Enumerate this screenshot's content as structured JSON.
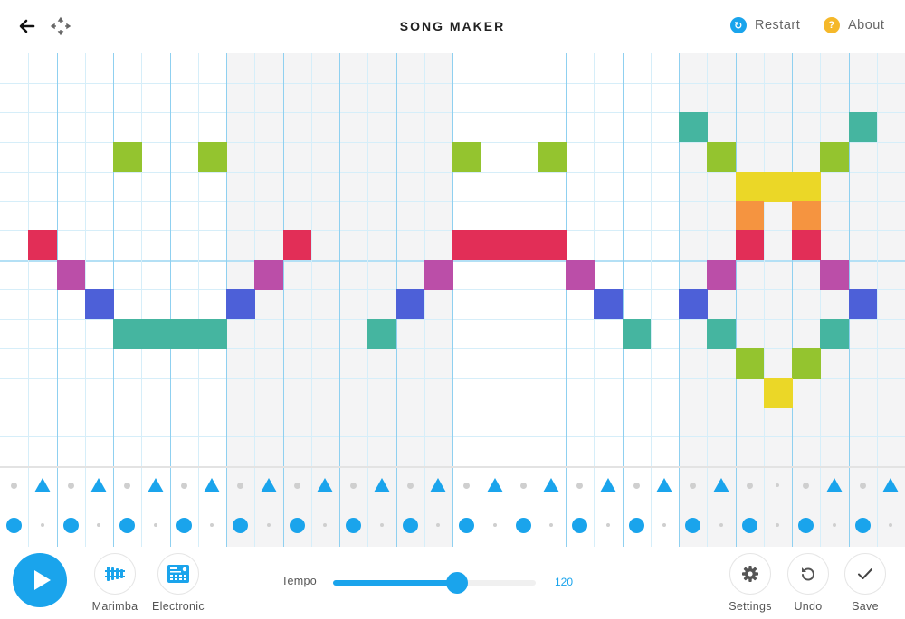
{
  "header": {
    "title": "SONG MAKER",
    "restart_label": "Restart",
    "about_label": "About",
    "restart_icon": "refresh-icon",
    "about_icon": "question-icon",
    "about_glyph": "?",
    "restart_glyph": "↻"
  },
  "colors": {
    "accent": "#1aa4ec",
    "about_accent": "#f5b82a",
    "shade": "#f4f4f5"
  },
  "grid": {
    "columns": 32,
    "rows": 14,
    "beats_per_bar": 4,
    "shaded_bars": [
      1,
      3
    ],
    "note_colors": {
      "teal": "#45b5a0",
      "green": "#94c42f",
      "yellow": "#ebd727",
      "orange": "#f59440",
      "red": "#e22e57",
      "purple": "#bb4ea8",
      "blue": "#4d60d8"
    },
    "notes": [
      {
        "col": 1,
        "row": 6,
        "color": "red"
      },
      {
        "col": 10,
        "row": 6,
        "color": "red"
      },
      {
        "col": 16,
        "row": 6,
        "color": "red"
      },
      {
        "col": 17,
        "row": 6,
        "color": "red"
      },
      {
        "col": 18,
        "row": 6,
        "color": "red"
      },
      {
        "col": 19,
        "row": 6,
        "color": "red"
      },
      {
        "col": 26,
        "row": 6,
        "color": "red"
      },
      {
        "col": 28,
        "row": 6,
        "color": "red"
      },
      {
        "col": 4,
        "row": 3,
        "color": "green"
      },
      {
        "col": 7,
        "row": 3,
        "color": "green"
      },
      {
        "col": 16,
        "row": 3,
        "color": "green"
      },
      {
        "col": 19,
        "row": 3,
        "color": "green"
      },
      {
        "col": 25,
        "row": 3,
        "color": "green"
      },
      {
        "col": 29,
        "row": 3,
        "color": "green"
      },
      {
        "col": 2,
        "row": 7,
        "color": "purple"
      },
      {
        "col": 9,
        "row": 7,
        "color": "purple"
      },
      {
        "col": 15,
        "row": 7,
        "color": "purple"
      },
      {
        "col": 20,
        "row": 7,
        "color": "purple"
      },
      {
        "col": 25,
        "row": 7,
        "color": "purple"
      },
      {
        "col": 29,
        "row": 7,
        "color": "purple"
      },
      {
        "col": 3,
        "row": 8,
        "color": "blue"
      },
      {
        "col": 8,
        "row": 8,
        "color": "blue"
      },
      {
        "col": 14,
        "row": 8,
        "color": "blue"
      },
      {
        "col": 21,
        "row": 8,
        "color": "blue"
      },
      {
        "col": 24,
        "row": 8,
        "color": "blue"
      },
      {
        "col": 30,
        "row": 8,
        "color": "blue"
      },
      {
        "col": 4,
        "row": 9,
        "color": "teal"
      },
      {
        "col": 5,
        "row": 9,
        "color": "teal"
      },
      {
        "col": 6,
        "row": 9,
        "color": "teal"
      },
      {
        "col": 7,
        "row": 9,
        "color": "teal"
      },
      {
        "col": 13,
        "row": 9,
        "color": "teal"
      },
      {
        "col": 22,
        "row": 9,
        "color": "teal"
      },
      {
        "col": 25,
        "row": 9,
        "color": "teal"
      },
      {
        "col": 29,
        "row": 9,
        "color": "teal"
      },
      {
        "col": 24,
        "row": 2,
        "color": "teal"
      },
      {
        "col": 30,
        "row": 2,
        "color": "teal"
      },
      {
        "col": 26,
        "row": 4,
        "color": "yellow"
      },
      {
        "col": 27,
        "row": 4,
        "color": "yellow"
      },
      {
        "col": 28,
        "row": 4,
        "color": "yellow"
      },
      {
        "col": 26,
        "row": 5,
        "color": "orange"
      },
      {
        "col": 28,
        "row": 5,
        "color": "orange"
      },
      {
        "col": 26,
        "row": 10,
        "color": "green"
      },
      {
        "col": 28,
        "row": 10,
        "color": "green"
      },
      {
        "col": 27,
        "row": 11,
        "color": "yellow"
      }
    ]
  },
  "rhythm": {
    "top_row": [
      "dot",
      "triangle",
      "dot",
      "triangle",
      "dot",
      "triangle",
      "dot",
      "triangle",
      "dot",
      "triangle",
      "dot",
      "triangle",
      "dot",
      "triangle",
      "dot",
      "triangle",
      "dot",
      "triangle",
      "dot",
      "triangle",
      "dot",
      "triangle",
      "dot",
      "triangle",
      "dot",
      "triangle",
      "dot",
      "small",
      "dot",
      "triangle",
      "dot",
      "triangle"
    ],
    "bottom_row": [
      "circle",
      "small",
      "circle",
      "small",
      "circle",
      "small",
      "circle",
      "small",
      "circle",
      "small",
      "circle",
      "small",
      "circle",
      "small",
      "circle",
      "small",
      "circle",
      "small",
      "circle",
      "small",
      "circle",
      "small",
      "circle",
      "small",
      "circle",
      "small",
      "circle",
      "small",
      "circle",
      "small",
      "circle",
      "small"
    ]
  },
  "toolbar": {
    "play_icon": "play-icon",
    "instruments": [
      {
        "label": "Marimba",
        "icon": "marimba-icon"
      },
      {
        "label": "Electronic",
        "icon": "drum-machine-icon"
      }
    ],
    "tempo_label": "Tempo",
    "tempo_value": "120",
    "tempo_fraction": 0.61,
    "actions": [
      {
        "label": "Settings",
        "icon": "gear-icon"
      },
      {
        "label": "Undo",
        "icon": "undo-icon"
      },
      {
        "label": "Save",
        "icon": "check-icon"
      }
    ]
  }
}
